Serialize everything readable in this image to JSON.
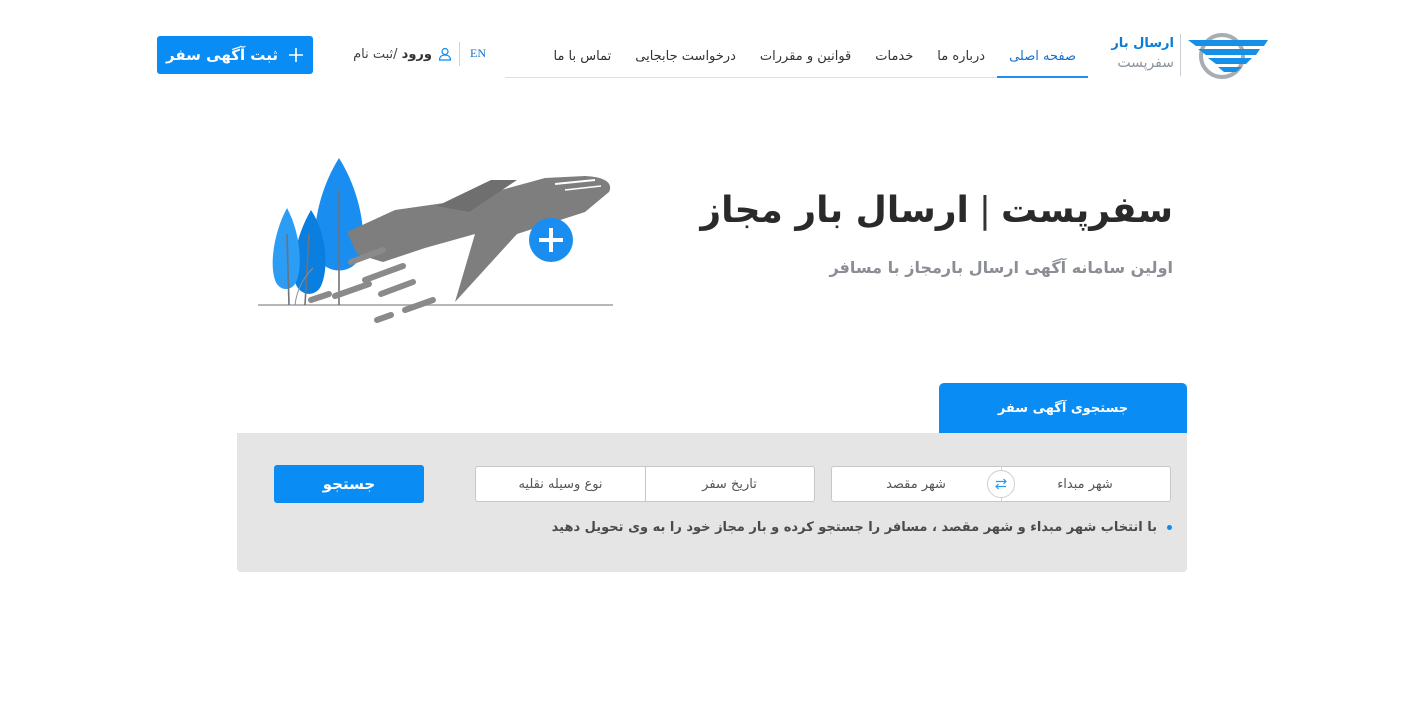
{
  "logo": {
    "line1": "ارسال بار",
    "line2": "سفرپست",
    "icon": "plane-logo-icon"
  },
  "nav": {
    "items": [
      {
        "label": "صفحه اصلی",
        "active": true
      },
      {
        "label": "درباره ما"
      },
      {
        "label": "خدمات"
      },
      {
        "label": "قوانین و مقررات"
      },
      {
        "label": "درخواست جابجایی"
      },
      {
        "label": "تماس با ما"
      }
    ],
    "lang": "EN",
    "login_bold": "ورود",
    "login_rest": "/ثبت نام",
    "login_icon": "user-icon"
  },
  "header_button": {
    "label": "ثبت آگهی سفر",
    "icon": "plus-icon"
  },
  "hero": {
    "title_part1": "سفرپست",
    "title_sep": "|",
    "title_part2": "ارسال بار مجاز",
    "subtitle": "اولین سامانه آگهی ارسال بارمجاز با مسافر",
    "illustration": "airplane-takeoff-illustration"
  },
  "search": {
    "tab_label": "جستجوی آگهی سفر",
    "origin_placeholder": "شهر مبداء",
    "destination_placeholder": "شهر مقصد",
    "swap_icon": "swap-arrows-icon",
    "date_label": "تاریخ سفر",
    "vehicle_label": "نوع وسیله نقلیه",
    "button_label": "جستجو",
    "hint": "با انتخاب شهر مبداء و شهر مقصد ، مسافر را جستجو کرده و بار مجاز خود را به وی تحویل دهید"
  },
  "colors": {
    "primary": "#0a8cf5",
    "panel": "#e5e5e5",
    "logo_blue": "#0a7cd6"
  }
}
